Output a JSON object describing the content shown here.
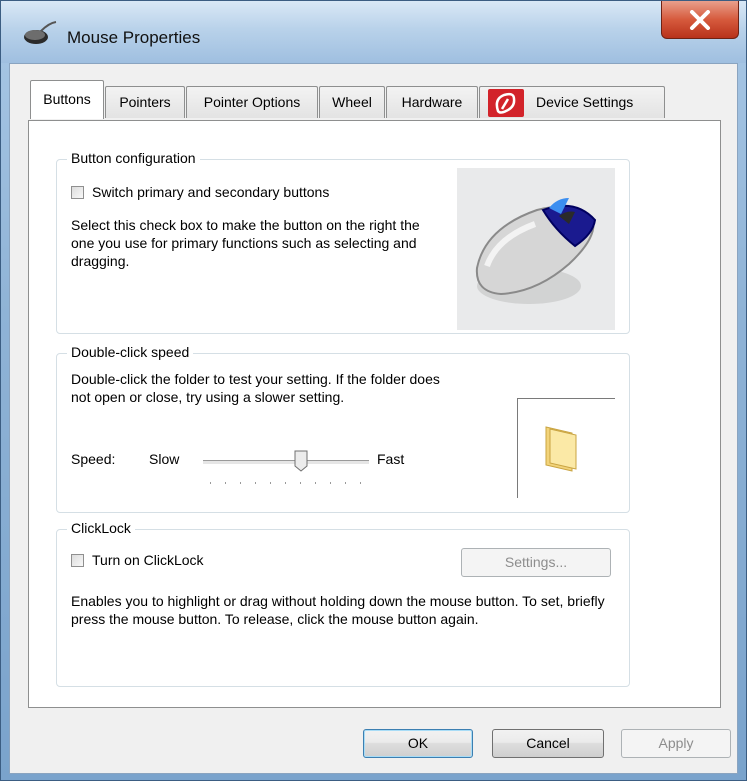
{
  "window": {
    "title": "Mouse Properties",
    "icon": "mouse-icon"
  },
  "tabs": [
    {
      "label": "Buttons",
      "active": true
    },
    {
      "label": "Pointers",
      "active": false
    },
    {
      "label": "Pointer Options",
      "active": false
    },
    {
      "label": "Wheel",
      "active": false
    },
    {
      "label": "Hardware",
      "active": false
    },
    {
      "label": "Device Settings",
      "active": false,
      "icon": "synaptics-icon"
    }
  ],
  "button_configuration": {
    "legend": "Button configuration",
    "checkbox_label": "Switch primary and secondary buttons",
    "checked": false,
    "description": "Select this check box to make the button on the right the one you use for primary functions such as selecting and dragging.",
    "image": "mouse-illustration"
  },
  "double_click": {
    "legend": "Double-click speed",
    "description": "Double-click the folder to test your setting. If the folder does not open or close, try using a slower setting.",
    "speed_label": "Speed:",
    "slow_label": "Slow",
    "fast_label": "Fast",
    "slider_value_fraction": 0.6,
    "test_icon": "folder-icon"
  },
  "clicklock": {
    "legend": "ClickLock",
    "checkbox_label": "Turn on ClickLock",
    "checked": false,
    "settings_label": "Settings...",
    "description": "Enables you to highlight or drag without holding down the mouse button. To set, briefly press the mouse button. To release, click the mouse button again."
  },
  "footer": {
    "ok_label": "OK",
    "cancel_label": "Cancel",
    "apply_label": "Apply"
  },
  "colors": {
    "accent": "#3c7fb1",
    "close_button": "#c8442a",
    "device_icon": "#d2232a"
  }
}
